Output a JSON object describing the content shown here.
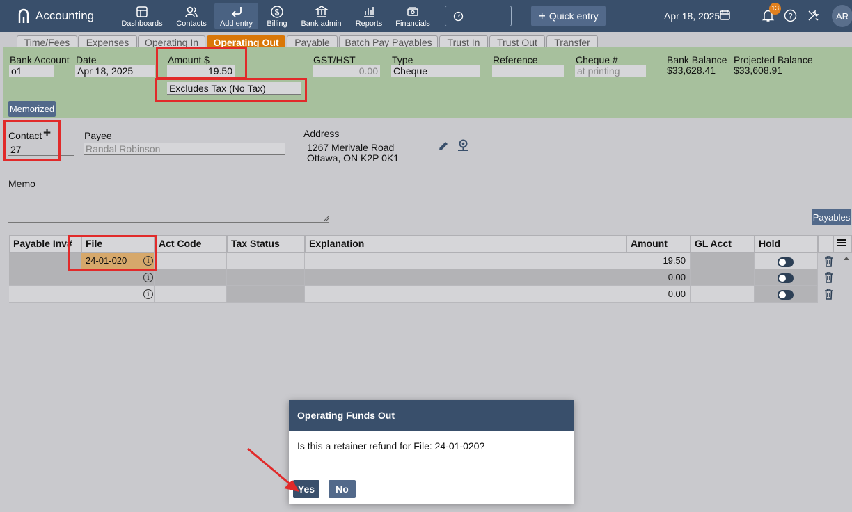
{
  "app": {
    "title": "Accounting"
  },
  "nav": [
    {
      "label": "Dashboards",
      "icon": "dashboard-icon"
    },
    {
      "label": "Contacts",
      "icon": "contacts-icon"
    },
    {
      "label": "Add entry",
      "icon": "add-entry-icon"
    },
    {
      "label": "Billing",
      "icon": "billing-icon"
    },
    {
      "label": "Bank admin",
      "icon": "bank-icon"
    },
    {
      "label": "Reports",
      "icon": "reports-icon"
    },
    {
      "label": "Financials",
      "icon": "financials-icon"
    }
  ],
  "header": {
    "quick_entry": "Quick entry",
    "date": "Apr 18, 2025",
    "notifications": "13",
    "avatar": "AR"
  },
  "tabs": [
    "Time/Fees",
    "Expenses",
    "Operating In",
    "Operating Out",
    "Payable",
    "Batch Pay Payables",
    "Trust In",
    "Trust Out",
    "Transfer"
  ],
  "form": {
    "bank_account_label": "Bank Account",
    "bank_account": "o1",
    "date_label": "Date",
    "date": "Apr 18, 2025",
    "amount_label": "Amount $",
    "amount": "19.50",
    "tax_option": "Excludes Tax (No Tax)",
    "gst_label": "GST/HST",
    "gst": "0.00",
    "type_label": "Type",
    "type": "Cheque",
    "reference_label": "Reference",
    "reference": "",
    "cheque_label": "Cheque #",
    "cheque": "at printing",
    "bank_balance_label": "Bank Balance",
    "bank_balance": "$33,628.41",
    "projected_balance_label": "Projected Balance",
    "projected_balance": "$33,608.91",
    "memorized": "Memorized"
  },
  "contact": {
    "contact_label": "Contact",
    "contact": "27",
    "payee_label": "Payee",
    "payee": "Randal Robinson",
    "address_label": "Address",
    "address_line1": "1267 Merivale Road",
    "address_line2": "Ottawa, ON K2P 0K1",
    "memo_label": "Memo",
    "payables": "Payables"
  },
  "table": {
    "headers": [
      "Payable Inv#",
      "File",
      "Act Code",
      "Tax Status",
      "Explanation",
      "Amount",
      "GL Acct",
      "Hold"
    ],
    "rows": [
      {
        "file": "24-01-020",
        "amount": "19.50"
      },
      {
        "file": "",
        "amount": "0.00"
      },
      {
        "file": "",
        "amount": "0.00"
      }
    ]
  },
  "dialog": {
    "title": "Operating Funds Out",
    "message": "Is this a retainer refund for File: 24-01-020?",
    "yes": "Yes",
    "no": "No"
  }
}
